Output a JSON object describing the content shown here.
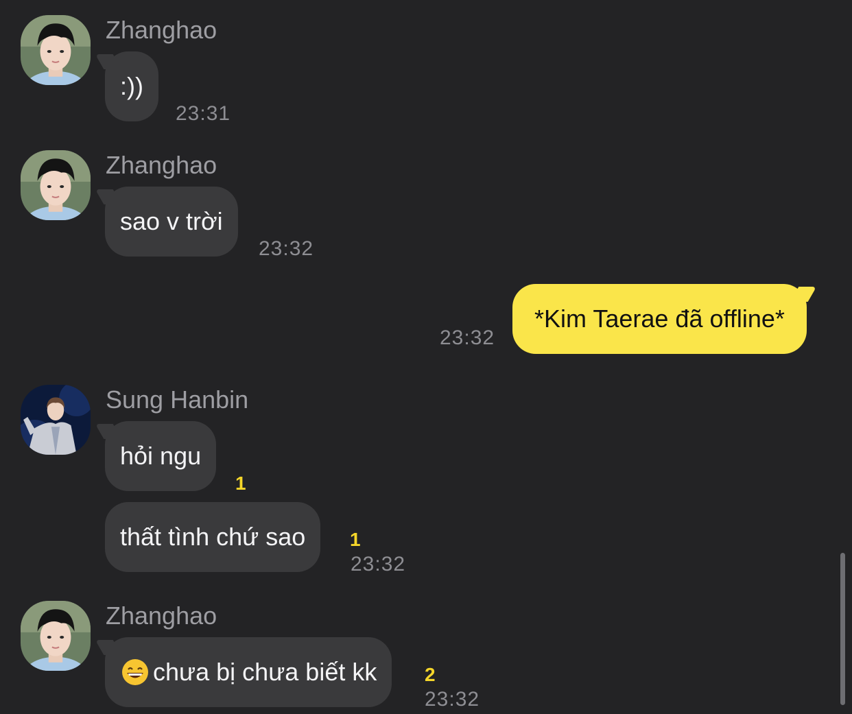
{
  "senders": {
    "zhanghao": "Zhanghao",
    "hanbin": "Sung Hanbin"
  },
  "messages": [
    {
      "sender": "Zhanghao",
      "text": ":))",
      "time": "23:31"
    },
    {
      "sender": "Zhanghao",
      "text": "sao v trời",
      "time": "23:32"
    },
    {
      "text": "*Kim Taerae đã offline*",
      "time": "23:32"
    },
    {
      "sender": "Sung Hanbin",
      "text": "hỏi ngu",
      "unread": "1"
    },
    {
      "text": "thất tình chứ sao",
      "unread": "1",
      "time": "23:32"
    },
    {
      "sender": "Zhanghao",
      "text": "chưa bị chưa biết kk",
      "emoji": "grinning-face-icon",
      "unread": "2",
      "time": "23:32"
    }
  ],
  "colors": {
    "background": "#232325",
    "incoming_bubble": "#3a3a3c",
    "outgoing_bubble": "#fae54a",
    "unread_count": "#f5d62a"
  }
}
